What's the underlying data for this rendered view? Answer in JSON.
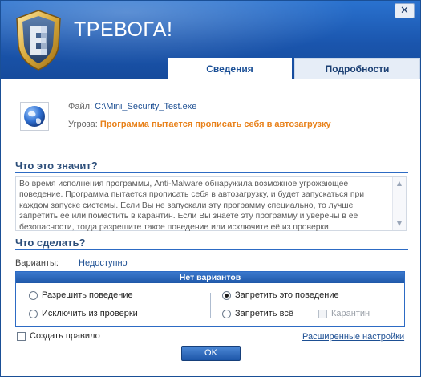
{
  "window": {
    "title": "ТРЕВОГА!",
    "close_glyph": "✕"
  },
  "tabs": [
    {
      "label": "Сведения",
      "active": true
    },
    {
      "label": "Подробности",
      "active": false
    }
  ],
  "file": {
    "label": "Файл:",
    "value": "C:\\Mini_Security_Test.exe",
    "icon": "globe-icon"
  },
  "threat": {
    "label": "Угроза:",
    "value": "Программа пытается прописать себя в автозагрузку"
  },
  "what_means": {
    "title": "Что это значит?",
    "text": "Во время исполнения программы, Anti-Malware обнаружила возможное угрожающее поведение. Программа пытается прописать себя в автозагрузку, и будет запускаться при каждом запуске системы. Если Вы не запускали эту программу специально, то лучше запретить её или поместить в карантин. Если Вы знаете эту программу и уверены в её безопасности, тогда разрешите такое поведение или исключите её из проверки."
  },
  "what_do": {
    "title": "Что сделать?"
  },
  "variants": {
    "label": "Варианты:",
    "value": "Недоступно"
  },
  "options": {
    "header": "Нет вариантов",
    "allow": "Разрешить поведение",
    "exclude": "Исключить из проверки",
    "deny_behavior": "Запретить это поведение",
    "deny_all": "Запретить всё",
    "quarantine": "Карантин",
    "selected": "deny_behavior"
  },
  "footer": {
    "create_rule": "Создать правило",
    "advanced": "Расширенные настройки",
    "ok": "OK"
  },
  "colors": {
    "header_blue": "#1c5cb3",
    "link_blue": "#1d4f93",
    "threat_orange": "#e8811a",
    "section_title": "#2b4d79"
  }
}
